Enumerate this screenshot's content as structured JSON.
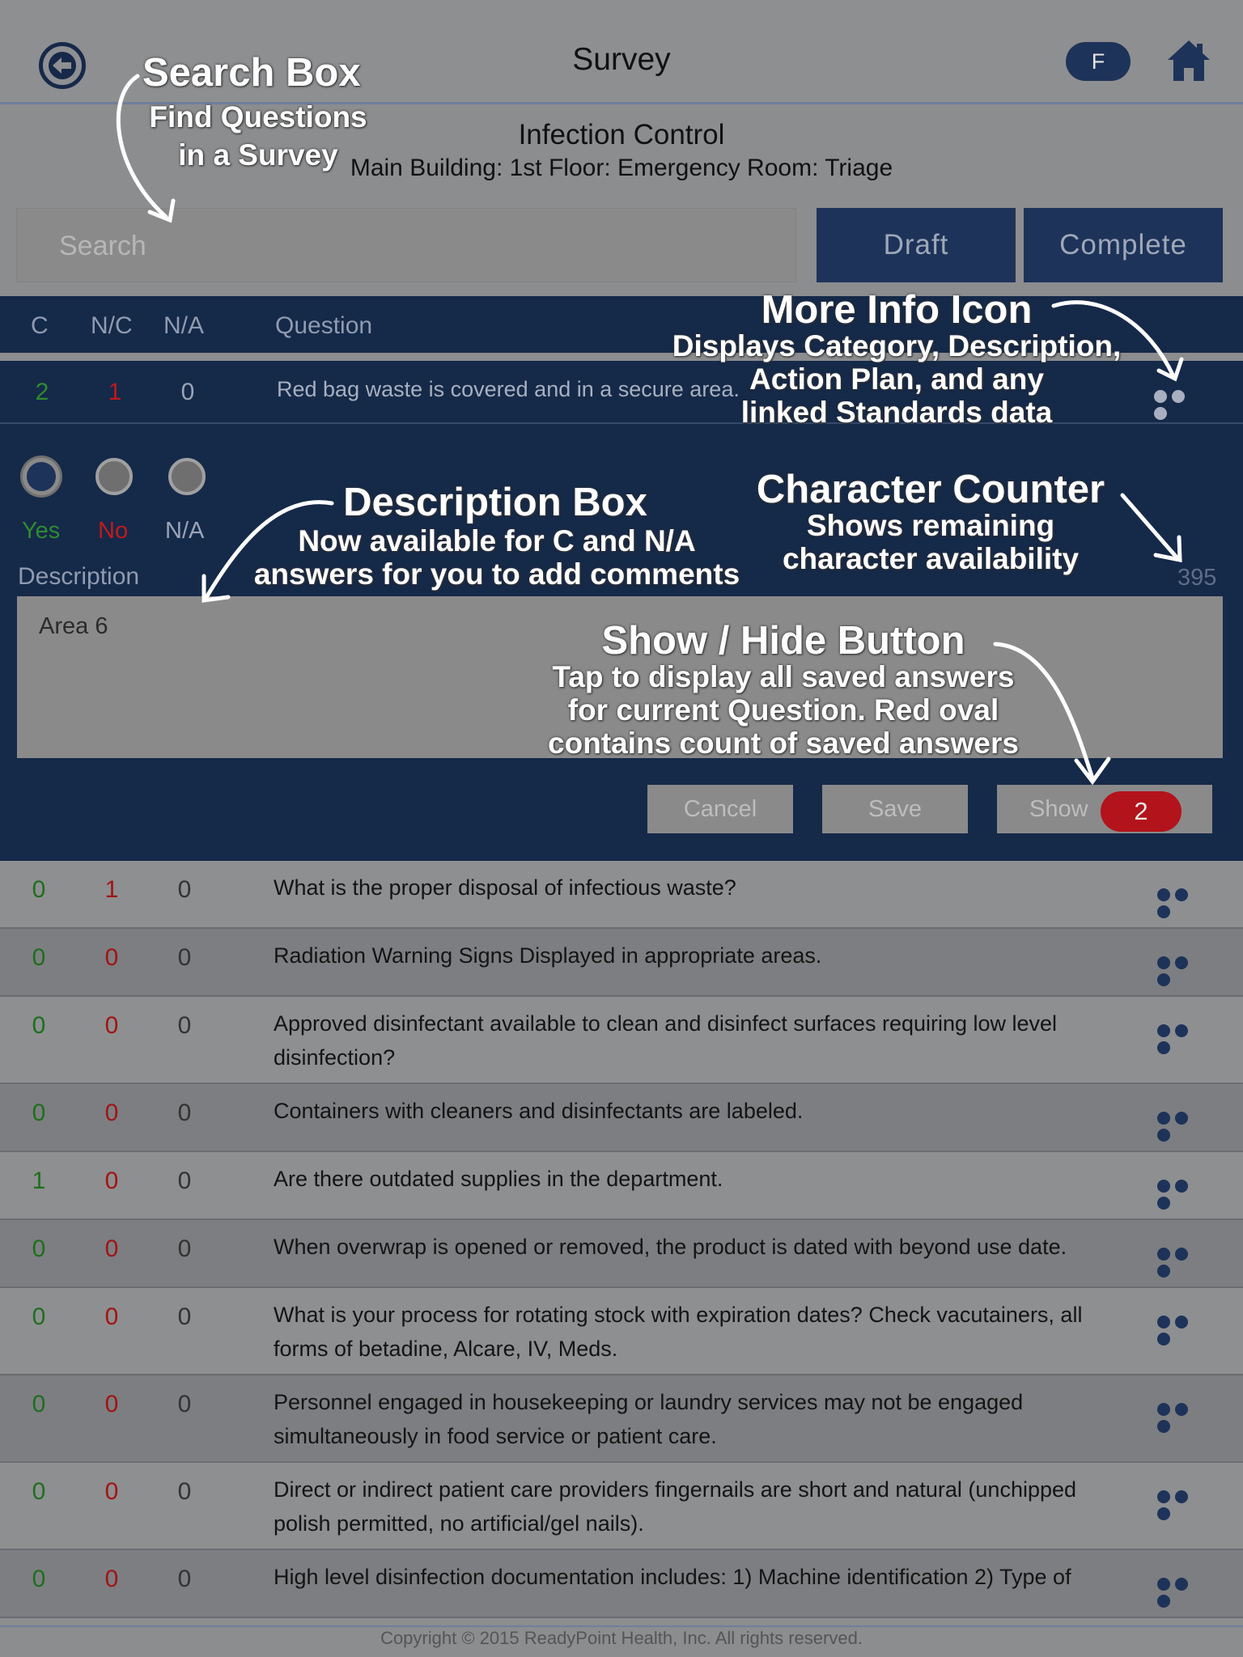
{
  "header": {
    "title": "Survey",
    "avatar_letter": "F",
    "survey_name": "Infection Control",
    "location": "Main Building: 1st Floor: Emergency Room: Triage"
  },
  "search": {
    "placeholder": "Search"
  },
  "status_buttons": {
    "draft": "Draft",
    "complete": "Complete"
  },
  "table_header": {
    "c": "C",
    "nc": "N/C",
    "na": "N/A",
    "question": "Question"
  },
  "active_question": {
    "c": "2",
    "nc": "1",
    "na": "0",
    "text": "Red bag waste is covered and in a secure area.",
    "answers": {
      "yes": "Yes",
      "no": "No",
      "na": "N/A"
    },
    "description_label": "Description",
    "char_counter": "395",
    "description_value": "Area 6",
    "cancel": "Cancel",
    "save": "Save",
    "show": "Show",
    "saved_count": "2"
  },
  "questions": [
    {
      "c": "0",
      "nc": "1",
      "na": "0",
      "text": "What is the proper disposal of infectious waste?"
    },
    {
      "c": "0",
      "nc": "0",
      "na": "0",
      "text": "Radiation Warning Signs Displayed in appropriate areas."
    },
    {
      "c": "0",
      "nc": "0",
      "na": "0",
      "text": "Approved disinfectant available to clean and disinfect surfaces requiring low level disinfection?"
    },
    {
      "c": "0",
      "nc": "0",
      "na": "0",
      "text": "Containers with cleaners and disinfectants are labeled."
    },
    {
      "c": "1",
      "nc": "0",
      "na": "0",
      "text": "Are there outdated supplies in the department."
    },
    {
      "c": "0",
      "nc": "0",
      "na": "0",
      "text": "When overwrap is opened or removed, the product is dated with beyond use date."
    },
    {
      "c": "0",
      "nc": "0",
      "na": "0",
      "text": "What is your process for rotating stock with expiration dates? Check vacutainers, all forms of betadine, Alcare, IV, Meds."
    },
    {
      "c": "0",
      "nc": "0",
      "na": "0",
      "text": "Personnel engaged in housekeeping or laundry services may not be engaged simultaneously in food service or patient care."
    },
    {
      "c": "0",
      "nc": "0",
      "na": "0",
      "text": "Direct or indirect patient care providers fingernails are short and natural (unchipped polish permitted, no artificial/gel nails)."
    },
    {
      "c": "0",
      "nc": "0",
      "na": "0",
      "text": "High level disinfection documentation includes: 1) Machine identification 2) Type of"
    }
  ],
  "annotations": {
    "search_title": "Search Box",
    "search_l1": "Find Questions",
    "search_l2": "in a Survey",
    "info_title": "More Info Icon",
    "info_l1": "Displays Category, Description,",
    "info_l2": "Action Plan, and any",
    "info_l3": "linked Standards data",
    "desc_title": "Description Box",
    "desc_l1": "Now available for C and N/A",
    "desc_l2": "answers for you to add comments",
    "counter_title": "Character Counter",
    "counter_l1": "Shows remaining",
    "counter_l2": "character availability",
    "show_title": "Show / Hide Button",
    "show_l1": "Tap to display all saved answers",
    "show_l2": "for current Question. Red oval",
    "show_l3": "contains count of saved answers"
  },
  "footer": "Copyright © 2015 ReadyPoint Health, Inc. All rights reserved."
}
